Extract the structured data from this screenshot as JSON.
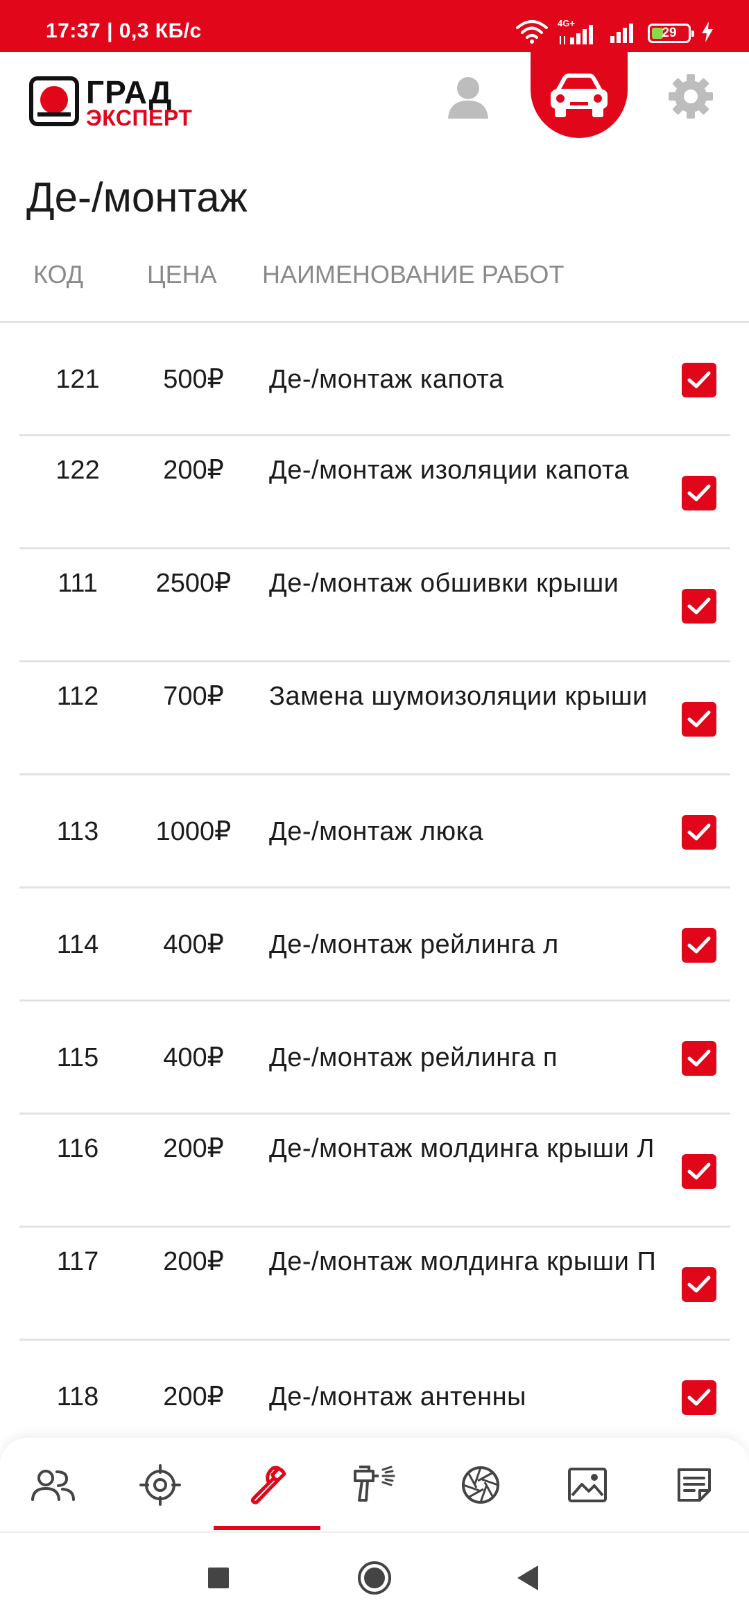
{
  "status_bar": {
    "time": "17:37 | 0,3 КБ/с",
    "network": "4G+",
    "battery": "29"
  },
  "header": {
    "logo_top": "ГРАД",
    "logo_bottom": "ЭКСПЕРТ",
    "icons": [
      "user-icon",
      "car-icon",
      "gear-icon"
    ],
    "active_icon": "car-icon"
  },
  "page": {
    "title": "Де-/монтаж"
  },
  "columns": {
    "code": "КОД",
    "price": "ЦЕНА",
    "name": "НАИМЕНОВАНИЕ РАБОТ"
  },
  "works": [
    {
      "code": "121",
      "price": "500₽",
      "name": "Де-/монтаж  капота",
      "checked": true
    },
    {
      "code": "122",
      "price": "200₽",
      "name": "Де-/монтаж  изоляции капота",
      "checked": true
    },
    {
      "code": "111",
      "price": "2500₽",
      "name": "Де-/монтаж обшивки крыши",
      "checked": true
    },
    {
      "code": "112",
      "price": "700₽",
      "name": "Замена шумоизоляции крыши",
      "checked": true
    },
    {
      "code": "113",
      "price": "1000₽",
      "name": "Де-/монтаж люка",
      "checked": true
    },
    {
      "code": "114",
      "price": "400₽",
      "name": "Де-/монтаж рейлинга л",
      "checked": true
    },
    {
      "code": "115",
      "price": "400₽",
      "name": "Де-/монтаж рейлинга п",
      "checked": true
    },
    {
      "code": "116",
      "price": "200₽",
      "name": "Де-/монтаж молдинга крыши Л",
      "checked": true
    },
    {
      "code": "117",
      "price": "200₽",
      "name": "Де-/монтаж молдинга крыши П",
      "checked": true
    },
    {
      "code": "118",
      "price": "200₽",
      "name": "Де-/монтаж антенны",
      "checked": true
    }
  ],
  "bottom_nav": {
    "items": [
      "people-icon",
      "target-icon",
      "wrench-icon",
      "spray-gun-icon",
      "aperture-icon",
      "image-icon",
      "note-icon"
    ],
    "active": "wrench-icon"
  },
  "colors": {
    "accent": "#e2061a",
    "muted": "#8a8a8a",
    "divider": "#e3e3e3"
  }
}
